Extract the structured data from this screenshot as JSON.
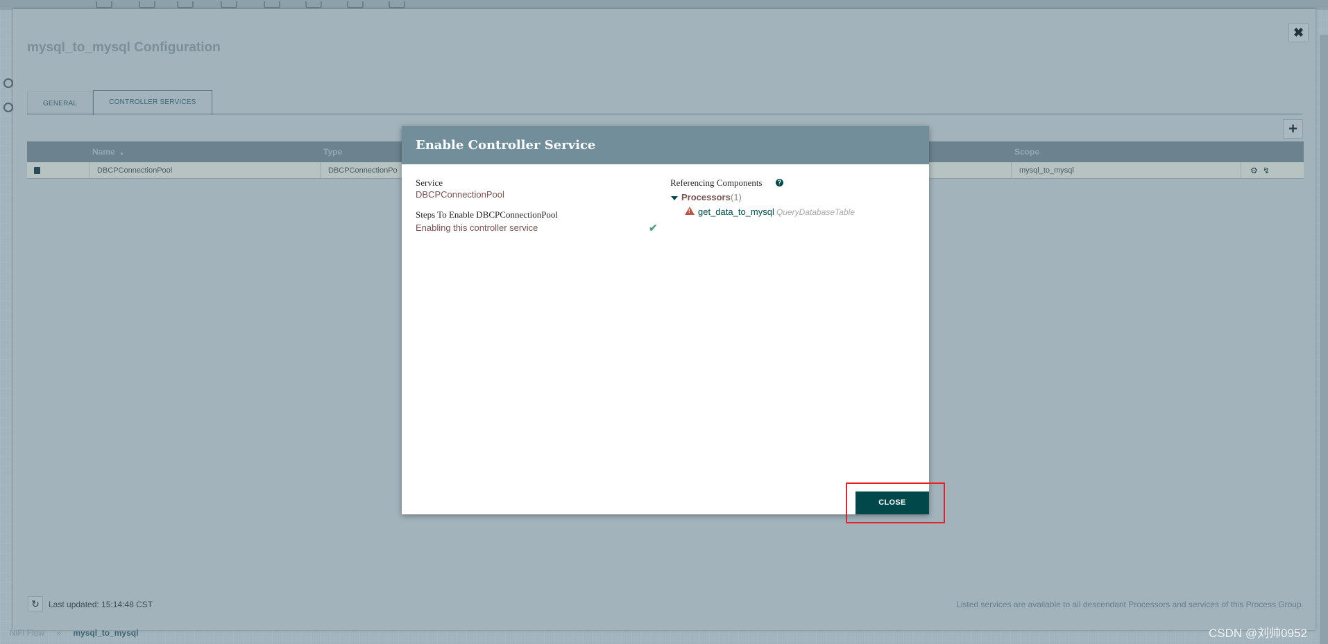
{
  "config": {
    "title": "mysql_to_mysql Configuration",
    "close_icon": "✖",
    "tabs": [
      {
        "label": "GENERAL"
      },
      {
        "label": "CONTROLLER SERVICES"
      }
    ],
    "add_icon": "+",
    "grid": {
      "headers": {
        "name": "Name",
        "sort_icon": "▲",
        "type": "Type",
        "scope": "Scope"
      },
      "row": {
        "name": "DBCPConnectionPool",
        "type": "DBCPConnectionPo",
        "scope": "mysql_to_mysql"
      }
    },
    "footer": {
      "refresh_icon": "↻",
      "last_updated": "Last updated: 15:14:48 CST",
      "note": "Listed services are available to all descendant Processors and services of this Process Group."
    }
  },
  "breadcrumb": {
    "root": "NiFi Flow",
    "separator": "»",
    "current": "mysql_to_mysql"
  },
  "watermark": "CSDN @刘帅0952",
  "dialog": {
    "title": "Enable Controller Service",
    "service_label": "Service",
    "service_value": "DBCPConnectionPool",
    "steps_label": "Steps To Enable DBCPConnectionPool",
    "step_1": "Enabling this controller service",
    "step_check": "✔",
    "ref_label": "Referencing Components",
    "help_icon": "?",
    "processors_label": "Processors",
    "processors_count": "(1)",
    "ref_component_name": "get_data_to_mysql",
    "ref_component_type": "QueryDatabaseTable",
    "close_button": "CLOSE"
  }
}
